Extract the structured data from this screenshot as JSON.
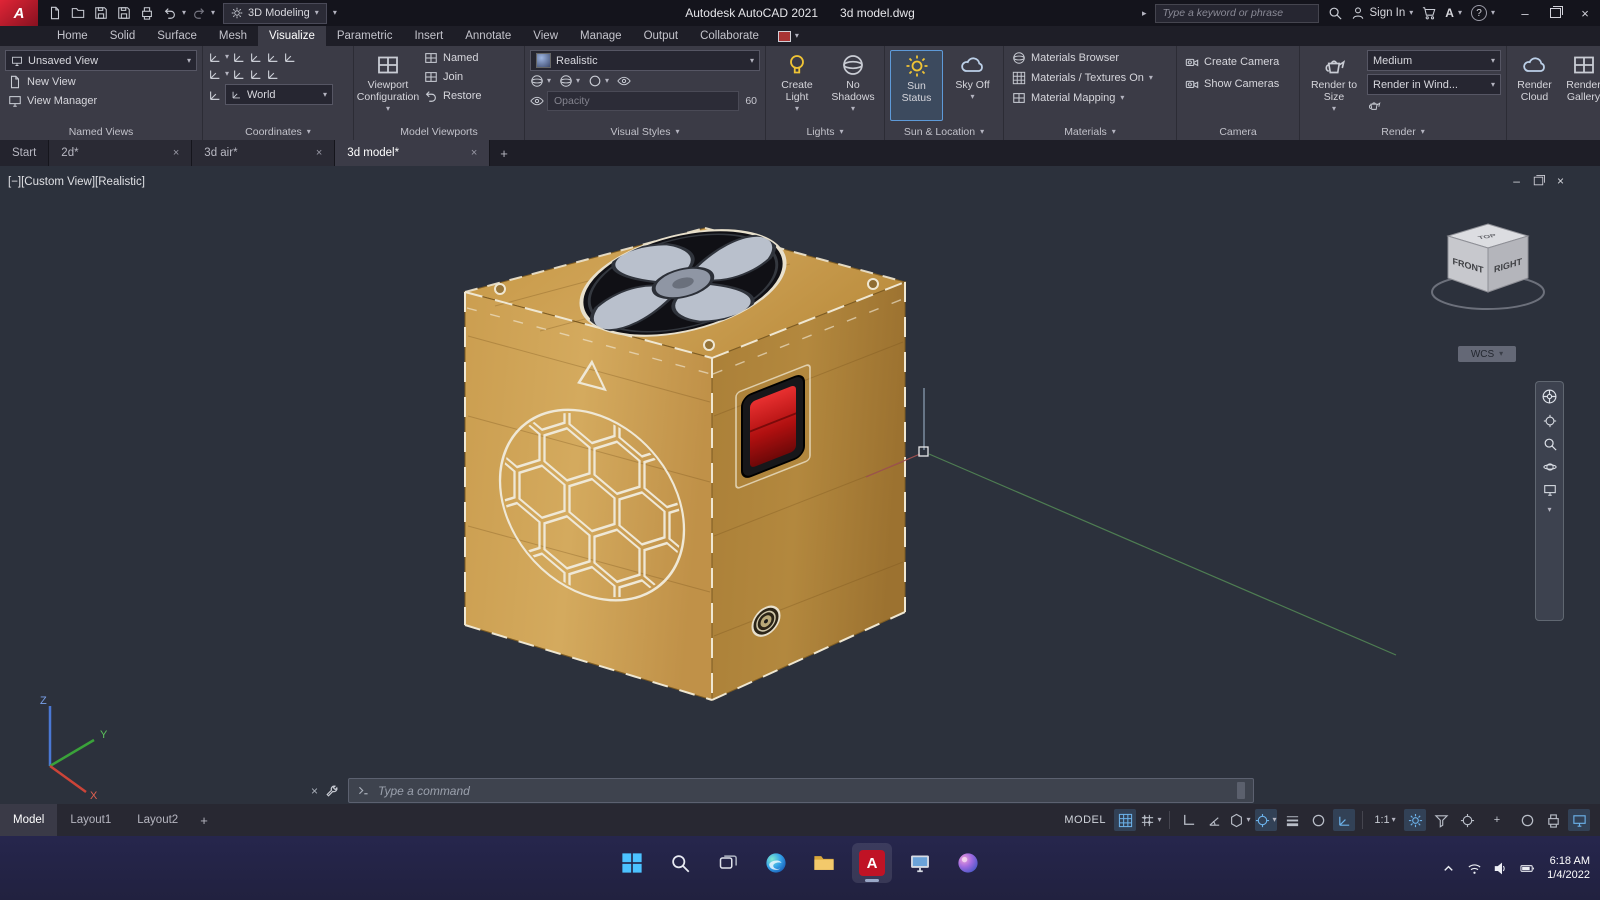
{
  "icons": {
    "caret_down": "▾",
    "caret_right": "▸",
    "close": "×",
    "minimize": "–",
    "plus": "+",
    "help": "?"
  },
  "titlebar": {
    "logo_letter": "A",
    "app_title": "Autodesk AutoCAD 2021",
    "doc_title": "3d model.dwg",
    "workspace": "3D Modeling",
    "search_placeholder": "Type a keyword or phrase",
    "sign_in": "Sign In"
  },
  "ribbon": {
    "tabs": [
      {
        "label": "Home"
      },
      {
        "label": "Solid"
      },
      {
        "label": "Surface"
      },
      {
        "label": "Mesh"
      },
      {
        "label": "Visualize"
      },
      {
        "label": "Parametric"
      },
      {
        "label": "Insert"
      },
      {
        "label": "Annotate"
      },
      {
        "label": "View"
      },
      {
        "label": "Manage"
      },
      {
        "label": "Output"
      },
      {
        "label": "Collaborate"
      }
    ],
    "named_views": {
      "current": "Unsaved View",
      "new_view": "New View",
      "view_manager": "View Manager",
      "label": "Named Views"
    },
    "coordinates": {
      "world": "World",
      "label": "Coordinates"
    },
    "model_viewports": {
      "config": "Viewport Configuration",
      "named": "Named",
      "join": "Join",
      "restore": "Restore",
      "label": "Model Viewports"
    },
    "visual_styles": {
      "current": "Realistic",
      "opacity": "Opacity",
      "opacity_value": "60",
      "label": "Visual Styles"
    },
    "lights": {
      "create": "Create Light",
      "shadows": "No Shadows",
      "label": "Lights"
    },
    "sun": {
      "status": "Sun Status",
      "sky": "Sky Off",
      "label": "Sun & Location"
    },
    "materials": {
      "browser": "Materials Browser",
      "textures": "Materials / Textures On",
      "mapping": "Material Mapping",
      "label": "Materials"
    },
    "camera": {
      "create": "Create Camera",
      "show": "Show Cameras",
      "label": "Camera"
    },
    "render": {
      "to_size": "Render to Size",
      "preset": "Medium",
      "in_window": "Render in Wind...",
      "cloud": "Render Cloud",
      "gallery": "Render Gallery",
      "label": "Render"
    }
  },
  "file_tabs": [
    {
      "label": "Start"
    },
    {
      "label": "2d*"
    },
    {
      "label": "3d air*"
    },
    {
      "label": "3d model*"
    }
  ],
  "viewport": {
    "vp_minus": "[−]",
    "vp_view": "[Custom View]",
    "vp_style": "[Realistic]",
    "viewcube": {
      "front": "FRONT",
      "right": "RIGHT",
      "top": "TOP"
    },
    "wcs": "WCS",
    "ucs_axes": {
      "x": "X",
      "y": "Y",
      "z": "Z"
    },
    "command_placeholder": "Type a command"
  },
  "statusbar": {
    "layout_tabs": [
      {
        "label": "Model"
      },
      {
        "label": "Layout1"
      },
      {
        "label": "Layout2"
      }
    ],
    "model_badge": "MODEL",
    "scale": "1:1"
  },
  "taskbar": {
    "time": "6:18 AM",
    "date": "1/4/2022"
  }
}
